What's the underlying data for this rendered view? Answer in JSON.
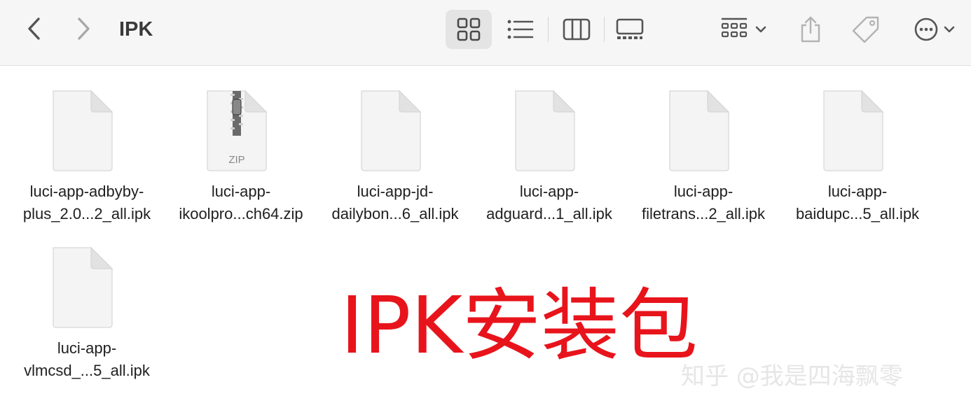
{
  "window": {
    "title": "IPK"
  },
  "toolbar": {
    "back_icon": "chevron-left-icon",
    "forward_icon": "chevron-right-icon",
    "view_modes": [
      "icon-view",
      "list-view",
      "column-view",
      "gallery-view"
    ],
    "active_view": "icon-view",
    "group_icon": "group-grid-icon",
    "share_icon": "share-icon",
    "tag_icon": "tag-icon",
    "more_icon": "ellipsis-circle-icon"
  },
  "files": [
    {
      "type": "document",
      "line1": "luci-app-adbyby-",
      "line2": "plus_2.0...2_all.ipk"
    },
    {
      "type": "zip",
      "badge": "ZIP",
      "line1": "luci-app-",
      "line2": "ikoolpro...ch64.zip"
    },
    {
      "type": "document",
      "line1": "luci-app-jd-",
      "line2": "dailybon...6_all.ipk"
    },
    {
      "type": "document",
      "line1": "luci-app-",
      "line2": "adguard...1_all.ipk"
    },
    {
      "type": "document",
      "line1": "luci-app-",
      "line2": "filetrans...2_all.ipk"
    },
    {
      "type": "document",
      "line1": "luci-app-",
      "line2": "baidupc...5_all.ipk"
    },
    {
      "type": "document",
      "line1": "luci-app-",
      "line2": "vlmcsd_...5_all.ipk"
    }
  ],
  "overlay": {
    "title": "IPK安装包",
    "color": "#e8141c"
  },
  "watermark": {
    "text": "知乎 @我是四海飘零"
  }
}
